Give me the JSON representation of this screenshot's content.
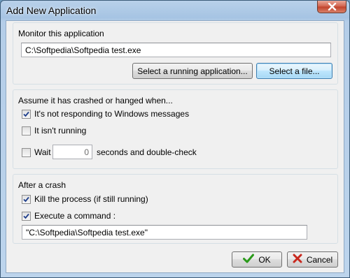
{
  "window": {
    "title": "Add New Application"
  },
  "monitor": {
    "group_label": "Monitor this application",
    "path_value": "C:\\Softpedia\\Softpedia test.exe",
    "select_running_label": "Select a running application...",
    "select_file_label": "Select a file..."
  },
  "crash": {
    "group_label": "Assume it has crashed or hanged when...",
    "not_responding": {
      "label": "It's not responding to Windows messages",
      "checked": true
    },
    "not_running": {
      "label": "It isn't running",
      "checked": false
    },
    "wait": {
      "label": "Wait",
      "checked": false,
      "seconds": "0",
      "suffix": "seconds and double-check"
    }
  },
  "after": {
    "group_label": "After a crash",
    "kill": {
      "label": "Kill the process (if still running)",
      "checked": true
    },
    "execute": {
      "label": "Execute a command :",
      "checked": true
    },
    "command_value": "\"C:\\Softpedia\\Softpedia test.exe\""
  },
  "buttons": {
    "ok_label": "OK",
    "cancel_label": "Cancel"
  },
  "colors": {
    "ok_check": "#2a9a1a",
    "cancel_x": "#c8281e",
    "checkmark": "#1e3e8c"
  },
  "icons": {
    "ok": "check-icon",
    "cancel": "x-icon",
    "close": "close-icon"
  }
}
